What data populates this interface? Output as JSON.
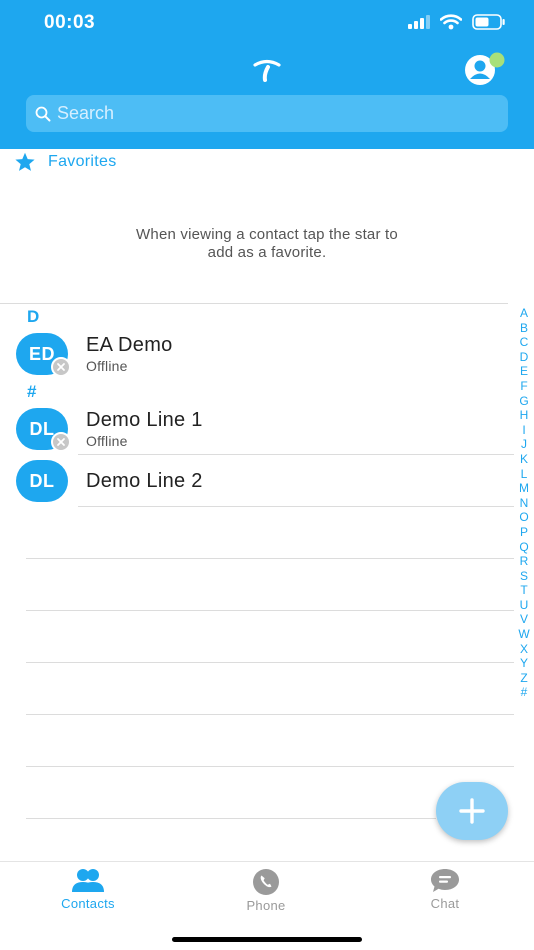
{
  "status_bar": {
    "time": "00:03"
  },
  "search": {
    "placeholder": "Search"
  },
  "favorites": {
    "label": "Favorites",
    "hint_line1": "When viewing a contact tap the star to",
    "hint_line2": "add as a favorite."
  },
  "sections": [
    {
      "letter": "D",
      "contacts": [
        {
          "initials": "ED",
          "name": "EA Demo",
          "status": "Offline"
        }
      ]
    },
    {
      "letter": "#",
      "contacts": [
        {
          "initials": "DL",
          "name": "Demo Line 1",
          "status": "Offline"
        },
        {
          "initials": "DL",
          "name": "Demo Line 2",
          "status": ""
        }
      ]
    }
  ],
  "alpha_index": [
    "A",
    "B",
    "C",
    "D",
    "E",
    "F",
    "G",
    "H",
    "I",
    "J",
    "K",
    "L",
    "M",
    "N",
    "O",
    "P",
    "Q",
    "R",
    "S",
    "T",
    "U",
    "V",
    "W",
    "X",
    "Y",
    "Z",
    "#"
  ],
  "tabs": [
    {
      "label": "Contacts",
      "icon": "contacts-icon",
      "active": true
    },
    {
      "label": "Phone",
      "icon": "phone-icon",
      "active": false
    },
    {
      "label": "Chat",
      "icon": "chat-icon",
      "active": false
    }
  ],
  "colors": {
    "accent": "#1ea7ef",
    "inactive": "#9a9a9a",
    "presence_offline": "#c7c7c7"
  }
}
